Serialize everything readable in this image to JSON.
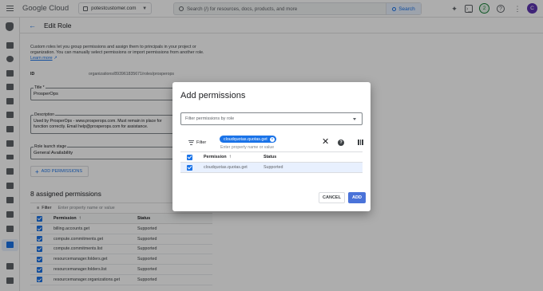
{
  "header": {
    "logo_google": "Google",
    "logo_cloud": "Cloud",
    "project": "potestcustomer.com",
    "search_placeholder": "Search (/) for resources, docs, products, and more",
    "search_button": "Search",
    "notification_count": "2",
    "avatar_letter": "C"
  },
  "page": {
    "title": "Edit Role",
    "intro": "Custom roles let you group permissions and assign them to principals in your project or organization. You can manually select permissions or import permissions from another role.",
    "learn_more": "Learn more",
    "id_label": "ID",
    "id_value": "organizations/893961835671/roles/prosperops",
    "title_label": "Title *",
    "title_value": "ProsperOps",
    "description_label": "Description",
    "description_value": "Used by ProsperOps - www.prosperops.com. Must remain in place for function correctly. Email help@prosperops.com for assistance.",
    "stage_label": "Role launch stage",
    "stage_value": "General Availability",
    "add_permissions_button": "ADD PERMISSIONS",
    "assigned_title": "8 assigned permissions",
    "filter_label": "Filter",
    "filter_placeholder": "Enter property name or value",
    "col_permission": "Permission",
    "col_status": "Status",
    "rows": [
      {
        "permission": "billing.accounts.get",
        "status": "Supported"
      },
      {
        "permission": "compute.commitments.get",
        "status": "Supported"
      },
      {
        "permission": "compute.commitments.list",
        "status": "Supported"
      },
      {
        "permission": "resourcemanager.folders.get",
        "status": "Supported"
      },
      {
        "permission": "resourcemanager.folders.list",
        "status": "Supported"
      },
      {
        "permission": "resourcemanager.organizations.get",
        "status": "Supported"
      }
    ]
  },
  "dialog": {
    "title": "Add permissions",
    "select_placeholder": "Filter permissions by role",
    "filter_label": "Filter",
    "chip_value": "cloudquotas.quotas.get",
    "filter_placeholder": "Enter property name or value",
    "col_permission": "Permission",
    "col_status": "Status",
    "rows": [
      {
        "permission": "cloudquotas.quotas.get",
        "status": "Supported"
      }
    ],
    "cancel_button": "CANCEL",
    "add_button": "ADD"
  },
  "colors": {
    "accent": "#1a73e8",
    "add_button": "#4a73d9",
    "scrim": "rgba(0,0,0,0.32)"
  }
}
